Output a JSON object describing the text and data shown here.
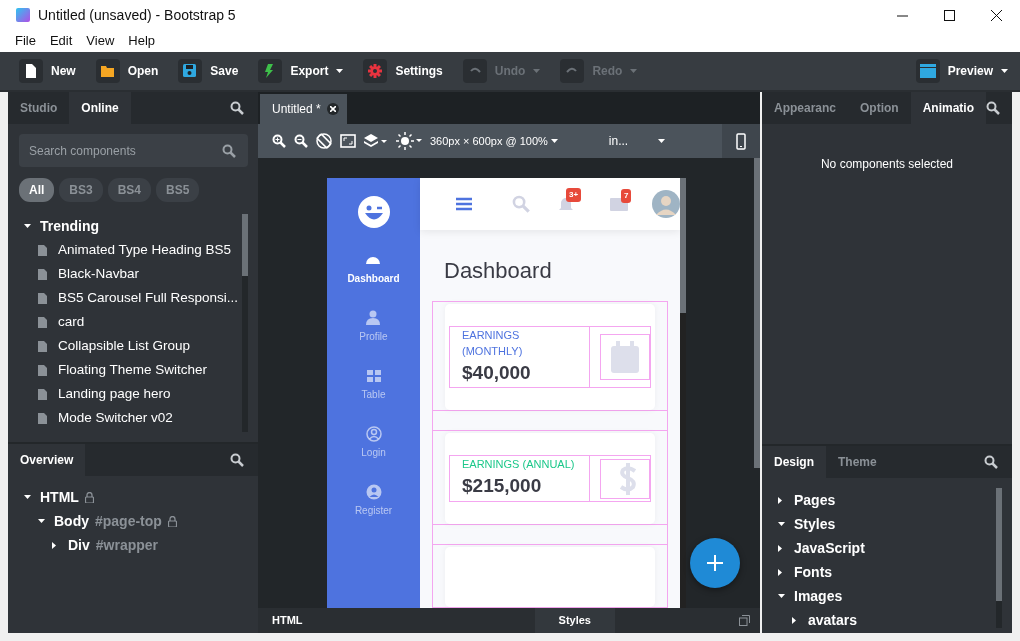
{
  "window": {
    "title": "Untitled (unsaved) - Bootstrap 5"
  },
  "menu": [
    "File",
    "Edit",
    "View",
    "Help"
  ],
  "toolbar": [
    {
      "label": "New",
      "disabled": false,
      "dropdown": false
    },
    {
      "label": "Open",
      "disabled": false,
      "dropdown": false
    },
    {
      "label": "Save",
      "disabled": false,
      "dropdown": false
    },
    {
      "label": "Export",
      "disabled": false,
      "dropdown": true
    },
    {
      "label": "Settings",
      "disabled": false,
      "dropdown": false
    },
    {
      "label": "Undo",
      "disabled": true,
      "dropdown": true
    },
    {
      "label": "Redo",
      "disabled": true,
      "dropdown": true
    }
  ],
  "preview_button": {
    "label": "Preview",
    "dropdown": true
  },
  "left_panel": {
    "tabs": [
      {
        "label": "Studio",
        "selected": false
      },
      {
        "label": "Online",
        "selected": true
      }
    ],
    "search": {
      "placeholder": "Search components"
    },
    "filters": [
      {
        "label": "All",
        "selected": true
      },
      {
        "label": "BS3",
        "selected": false
      },
      {
        "label": "BS4",
        "selected": false
      },
      {
        "label": "BS5",
        "selected": false
      }
    ],
    "tree": [
      {
        "label": "Trending",
        "expanded": true,
        "children": [
          {
            "label": "Animated Type Heading BS5"
          },
          {
            "label": "Black-Navbar"
          },
          {
            "label": "BS5 Carousel Full Responsi..."
          },
          {
            "label": "card"
          },
          {
            "label": "Collapsible List Group"
          },
          {
            "label": "Floating Theme Switcher"
          },
          {
            "label": "Landing page hero"
          },
          {
            "label": "Mode Switcher v02"
          }
        ]
      }
    ]
  },
  "overview": {
    "tabs": [
      {
        "label": "Overview",
        "selected": true
      }
    ],
    "tree": [
      {
        "label": "HTML",
        "locked": true,
        "expanded": true,
        "children": [
          {
            "label": "Body",
            "tag": "#page-top",
            "locked": true,
            "expanded": true,
            "children": [
              {
                "label": "Div",
                "tag": "#wrapper",
                "locked": false,
                "expanded": false
              }
            ]
          }
        ]
      }
    ]
  },
  "document_tab": {
    "title": "Untitled *"
  },
  "canvas_toolbar": {
    "size": "360px × 600px @ 100%",
    "device": "in..."
  },
  "preview": {
    "sidebar": [
      {
        "label": "Dashboard",
        "selected": true
      },
      {
        "label": "Profile",
        "selected": false
      },
      {
        "label": "Table",
        "selected": false
      },
      {
        "label": "Login",
        "selected": false
      },
      {
        "label": "Register",
        "selected": false
      }
    ],
    "badges": [
      "3+",
      "7"
    ],
    "heading": "Dashboard",
    "cards": [
      {
        "label": "EARNINGS (MONTHLY)",
        "value": "$40,000",
        "color": "#4e73df"
      },
      {
        "label": "EARNINGS (ANNUAL)",
        "value": "$215,000",
        "color": "#1cc88a"
      }
    ]
  },
  "bottom_tabs": [
    {
      "label": "HTML",
      "selected": false
    },
    {
      "label": "Styles",
      "selected": true
    }
  ],
  "right_panel": {
    "tabs": [
      {
        "label": "Appearanc",
        "selected": false
      },
      {
        "label": "Option",
        "selected": false
      },
      {
        "label": "Animatio",
        "selected": true
      }
    ],
    "message": "No components selected"
  },
  "design_panel": {
    "tabs": [
      {
        "label": "Design",
        "selected": true
      },
      {
        "label": "Theme",
        "selected": false
      }
    ],
    "tree": [
      {
        "label": "Pages",
        "expanded": false
      },
      {
        "label": "Styles",
        "expanded": true
      },
      {
        "label": "JavaScript",
        "expanded": false
      },
      {
        "label": "Fonts",
        "expanded": false
      },
      {
        "label": "Images",
        "expanded": true,
        "children": [
          {
            "label": "avatars",
            "expanded": false
          }
        ]
      }
    ]
  }
}
